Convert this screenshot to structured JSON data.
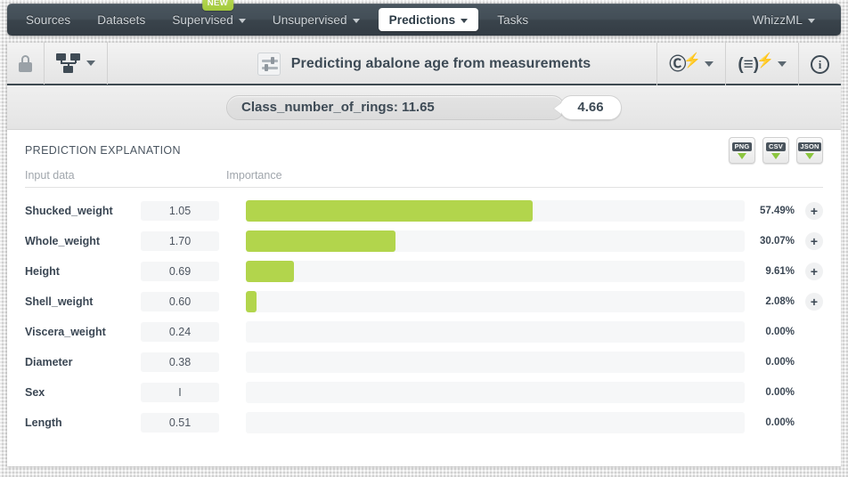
{
  "navbar": {
    "items": [
      {
        "label": "Sources",
        "caret": false,
        "active": false,
        "badge": null
      },
      {
        "label": "Datasets",
        "caret": false,
        "active": false,
        "badge": null
      },
      {
        "label": "Supervised",
        "caret": true,
        "active": false,
        "badge": "NEW"
      },
      {
        "label": "Unsupervised",
        "caret": true,
        "active": false,
        "badge": null
      },
      {
        "label": "Predictions",
        "caret": true,
        "active": true,
        "badge": null
      },
      {
        "label": "Tasks",
        "caret": false,
        "active": false,
        "badge": null
      }
    ],
    "account": {
      "label": "WhizzML",
      "caret": true
    }
  },
  "toolbar": {
    "lock_icon": "lock-icon",
    "model_icon": "decision-tree-icon",
    "title_icon": "prediction-sliders-icon",
    "title": "Predicting abalone age from measurements",
    "actions": [
      {
        "name": "batch-prediction-icon",
        "glyph": "C"
      },
      {
        "name": "evaluation-icon",
        "glyph": "(=)"
      },
      {
        "name": "info-icon",
        "glyph": "i"
      }
    ]
  },
  "prediction": {
    "objective_label": "Class_number_of_rings: 11.65",
    "confidence": "4.66"
  },
  "explanation": {
    "section_title": "PREDICTION EXPLANATION",
    "columns": {
      "input": "Input data",
      "importance": "Importance"
    },
    "exports": [
      {
        "name": "export-png-button",
        "label": "PNG"
      },
      {
        "name": "export-csv-button",
        "label": "CSV"
      },
      {
        "name": "export-json-button",
        "label": "JSON"
      }
    ],
    "accent_color": "#b2d54c",
    "rows": [
      {
        "field": "Shucked_weight",
        "value": "1.05",
        "percent": "57.49%",
        "width": 57.49,
        "expandable": true
      },
      {
        "field": "Whole_weight",
        "value": "1.70",
        "percent": "30.07%",
        "width": 30.07,
        "expandable": true
      },
      {
        "field": "Height",
        "value": "0.69",
        "percent": "9.61%",
        "width": 9.61,
        "expandable": true
      },
      {
        "field": "Shell_weight",
        "value": "0.60",
        "percent": "2.08%",
        "width": 2.08,
        "expandable": true
      },
      {
        "field": "Viscera_weight",
        "value": "0.24",
        "percent": "0.00%",
        "width": 0,
        "expandable": false
      },
      {
        "field": "Diameter",
        "value": "0.38",
        "percent": "0.00%",
        "width": 0,
        "expandable": false
      },
      {
        "field": "Sex",
        "value": "I",
        "percent": "0.00%",
        "width": 0,
        "expandable": false
      },
      {
        "field": "Length",
        "value": "0.51",
        "percent": "0.00%",
        "width": 0,
        "expandable": false
      }
    ],
    "expand_glyph": "+"
  },
  "chart_data": {
    "type": "bar",
    "title": "PREDICTION EXPLANATION",
    "xlabel": "Importance",
    "ylabel": "Input data",
    "categories": [
      "Shucked_weight",
      "Whole_weight",
      "Height",
      "Shell_weight",
      "Viscera_weight",
      "Diameter",
      "Sex",
      "Length"
    ],
    "values": [
      57.49,
      30.07,
      9.61,
      2.08,
      0.0,
      0.0,
      0.0,
      0.0
    ],
    "input_values": [
      "1.05",
      "1.70",
      "0.69",
      "0.60",
      "0.24",
      "0.38",
      "I",
      "0.51"
    ],
    "xlim": [
      0,
      100
    ],
    "grid": false,
    "legend": "none",
    "orientation": "horizontal"
  }
}
